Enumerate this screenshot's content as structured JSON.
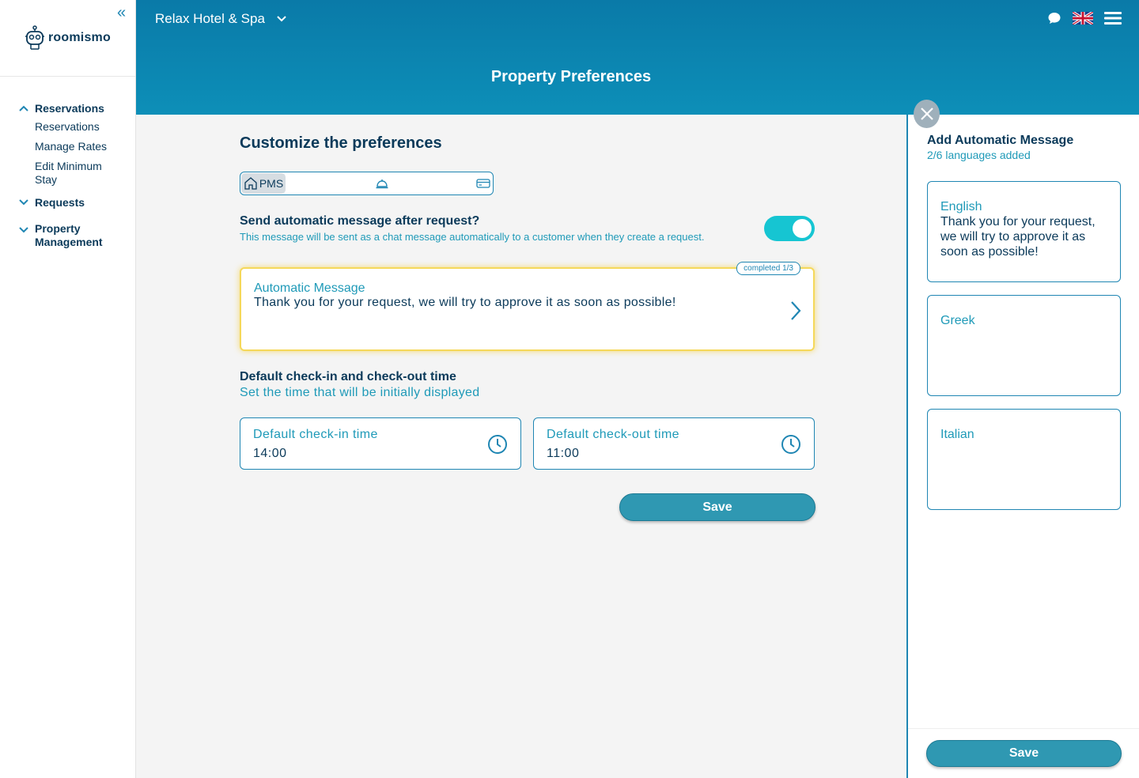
{
  "sidebar": {
    "logo_text": "roomismo",
    "groups": [
      {
        "label": "Reservations",
        "expanded": true,
        "items": [
          "Reservations",
          "Manage Rates",
          "Edit Minimum Stay"
        ]
      },
      {
        "label": "Requests",
        "expanded": false
      },
      {
        "label": "Property Management",
        "expanded": false
      }
    ]
  },
  "header": {
    "hotel_name": "Relax Hotel & Spa",
    "page_title": "Property Preferences",
    "icons": [
      "chat-icon",
      "uk-flag-icon",
      "hamburger-menu-icon"
    ]
  },
  "main": {
    "title": "Customize the preferences",
    "tabs": [
      {
        "label": "PMS",
        "icon": "home-icon",
        "active": true
      },
      {
        "label": "",
        "icon": "bell-icon",
        "active": false
      },
      {
        "label": "",
        "icon": "credit-card-icon",
        "active": false
      }
    ],
    "auto_message": {
      "question": "Send automatic message after request?",
      "description": "This message will be sent as a chat message automatically to a customer when they create a request.",
      "enabled": true,
      "card_label": "Automatic Message",
      "card_text": "Thank you for your request, we will try to approve it as soon as possible!",
      "badge": "completed 1/3"
    },
    "checkin": {
      "title": "Default check-in and check-out time",
      "subtitle": "Set the time that will be initially displayed",
      "checkin_label": "Default check-in time",
      "checkin_value": "14:00",
      "checkout_label": "Default check-out time",
      "checkout_value": "11:00"
    },
    "save_label": "Save"
  },
  "panel": {
    "title": "Add Automatic Message",
    "subtitle": "2/6 languages added",
    "languages": [
      {
        "name": "English",
        "text": "Thank you for your request, we will try to approve it as soon as possible!"
      },
      {
        "name": "Greek",
        "text": ""
      },
      {
        "name": "Italian",
        "text": ""
      }
    ],
    "save_label": "Save"
  },
  "colors": {
    "primary": "#0b3a5a",
    "accent": "#1f86b3",
    "header_bg": "#0a7aa8",
    "toggle_on": "#16c5d2",
    "highlight": "#f5d85a",
    "button": "#2f98b2"
  }
}
